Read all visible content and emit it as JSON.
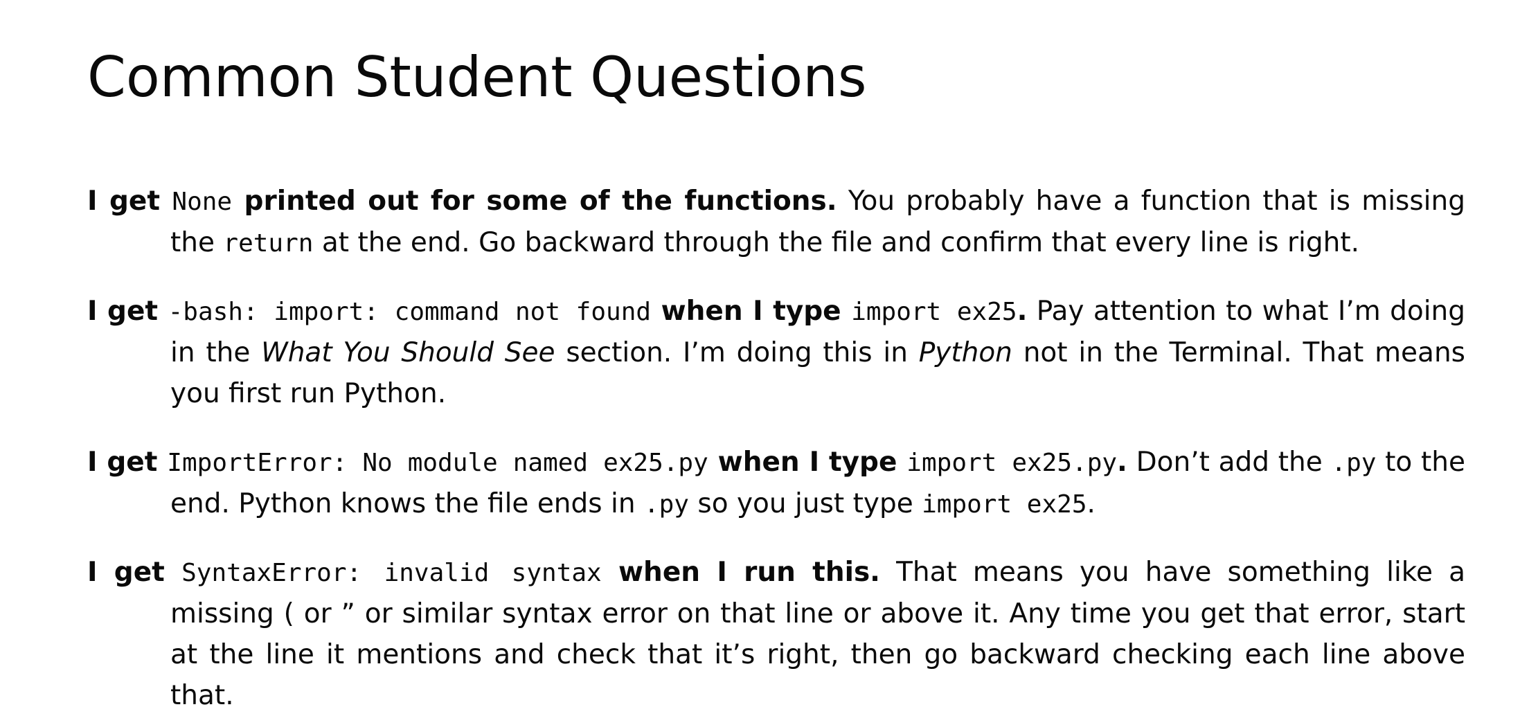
{
  "title": "Common Student Questions",
  "questions": [
    {
      "q_pre": "I get ",
      "q_code": "None",
      "q_post": " printed out for some of the functions.",
      "answer": [
        {
          "t": " You probably have a function that is missing the "
        },
        {
          "c": "return"
        },
        {
          "t": " at the end. Go backward through the file and confirm that every line is right."
        }
      ]
    },
    {
      "q_pre": "I get ",
      "q_code": "-bash: import: command not found",
      "q_mid": " when I type ",
      "q_code2": "import ex25",
      "q_post": ".",
      "answer": [
        {
          "t": " Pay attention to what I’m doing in the "
        },
        {
          "i": "What You Should See"
        },
        {
          "t": " section. I’m doing this in "
        },
        {
          "i": "Python"
        },
        {
          "t": " not in the Terminal. That means you first run Python."
        }
      ]
    },
    {
      "q_pre": "I get ",
      "q_code": "ImportError: No module named ex25.py",
      "q_mid": " when I type ",
      "q_code2": "import ex25.py",
      "q_post": ".",
      "answer": [
        {
          "t": " Don’t add the "
        },
        {
          "c": ".py"
        },
        {
          "t": " to the end. Python knows the file ends in "
        },
        {
          "c": ".py"
        },
        {
          "t": " so you just type "
        },
        {
          "c": "import ex25"
        },
        {
          "t": "."
        }
      ]
    },
    {
      "q_pre": "I get ",
      "q_code": "SyntaxError: invalid syntax",
      "q_post": " when I run this.",
      "answer": [
        {
          "t": " That means you have something like a missing ( or ” or similar syntax error on that line or above it. Any time you get that error, start at the line it mentions and check that it’s right, then go backward checking each line above that."
        }
      ]
    }
  ]
}
